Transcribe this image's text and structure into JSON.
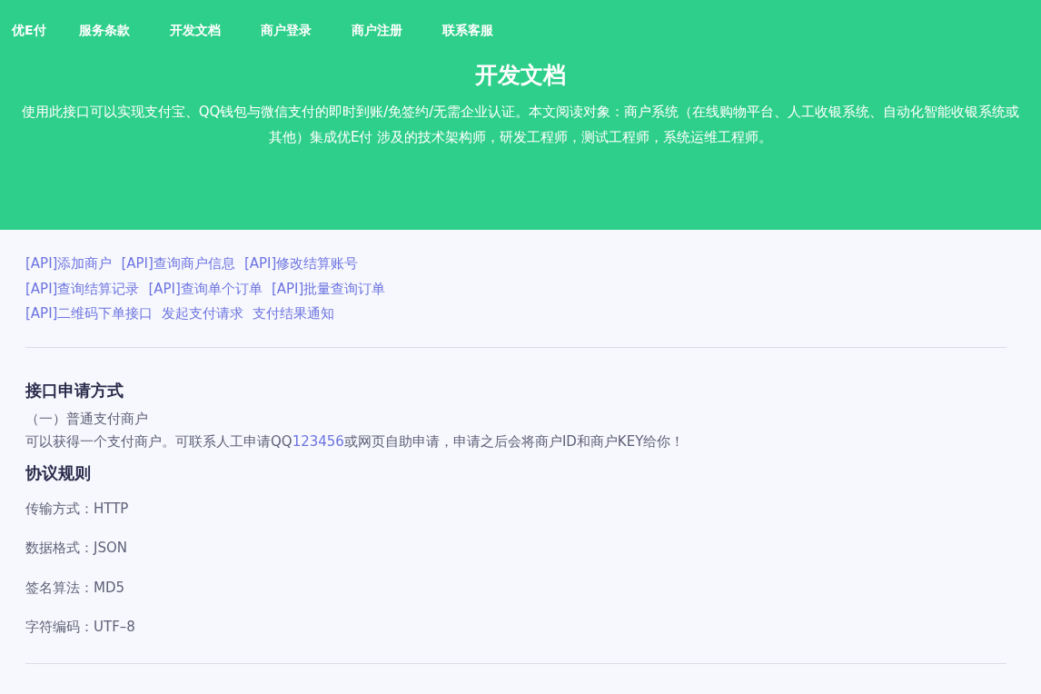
{
  "nav": {
    "brand": "优E付",
    "items": [
      {
        "label": "服务条款"
      },
      {
        "label": "开发文档"
      },
      {
        "label": "商户登录"
      },
      {
        "label": "商户注册"
      },
      {
        "label": "联系客服"
      }
    ]
  },
  "hero": {
    "title": "开发文档",
    "description": "使用此接口可以实现支付宝、QQ钱包与微信支付的即时到账/免签约/无需企业认证。本文阅读对象：商户系统（在线购物平台、人工收银系统、自动化智能收银系统或其他）集成优E付 涉及的技术架构师，研发工程师，测试工程师，系统运维工程师。"
  },
  "doc_links": [
    [
      "[API]添加商户",
      "[API]查询商户信息",
      "[API]修改结算账号"
    ],
    [
      "[API]查询结算记录",
      "[API]查询单个订单",
      "[API]批量查询订单"
    ],
    [
      "[API]二维码下单接口",
      "发起支付请求",
      "支付结果通知"
    ]
  ],
  "apply": {
    "heading": "接口申请方式",
    "subheading": "（一）普通支付商户",
    "text_before": "可以获得一个支付商户。可联系人工申请QQ",
    "link": "123456",
    "text_after": "或网页自助申请，申请之后会将商户ID和商户KEY给你！"
  },
  "rules": {
    "heading": "协议规则",
    "items": [
      "传输方式：HTTP",
      "数据格式：JSON",
      "签名算法：MD5",
      "字符编码：UTF–8"
    ]
  }
}
